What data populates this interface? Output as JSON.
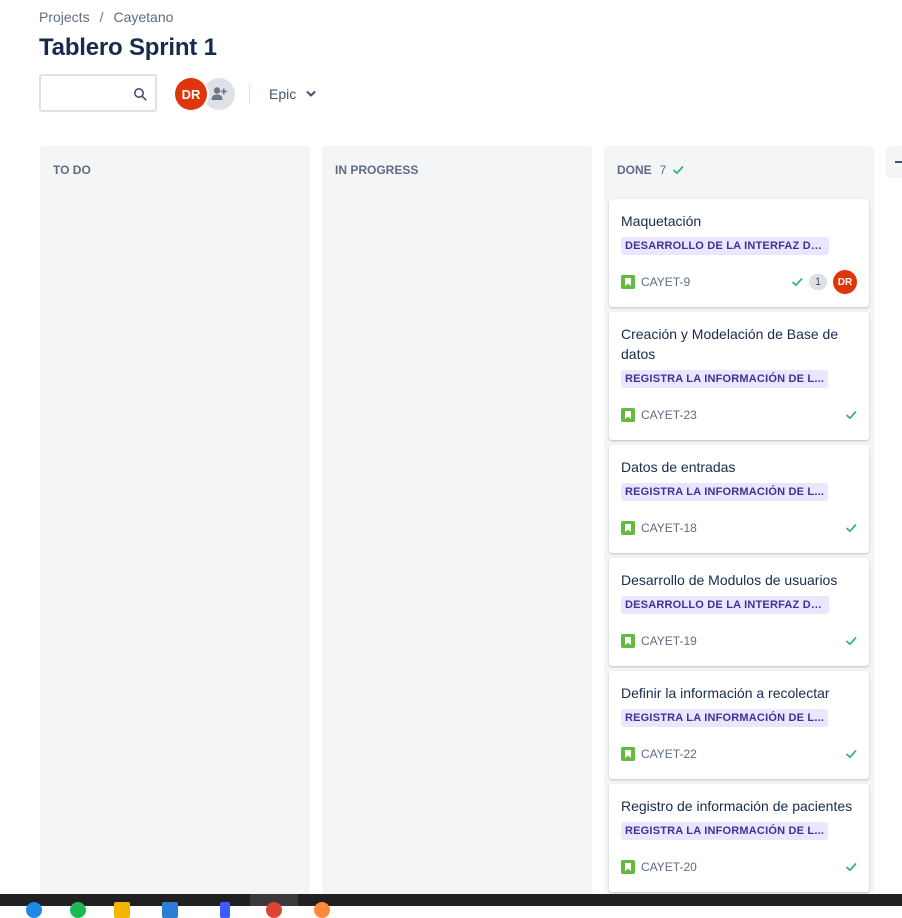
{
  "breadcrumb": {
    "items": [
      "Projects",
      "Cayetano"
    ],
    "separator": "/"
  },
  "page_title": "Tablero Sprint 1",
  "toolbar": {
    "search": {
      "value": "",
      "placeholder": ""
    },
    "avatar_initials": "DR",
    "epic_filter": "Epic"
  },
  "columns": [
    {
      "name": "TO DO"
    },
    {
      "name": "IN PROGRESS"
    },
    {
      "name": "DONE",
      "count": "7"
    }
  ],
  "cards": [
    {
      "summary": "Maquetación",
      "epic": "DESARROLLO DE LA INTERFAZ DE ...",
      "key": "CAYET-9",
      "subtasks": "1",
      "assignee": "DR"
    },
    {
      "summary": "Creación y Modelación de Base de datos",
      "epic": "REGISTRA LA INFORMACIÓN DE L...",
      "key": "CAYET-23"
    },
    {
      "summary": "Datos de entradas",
      "epic": "REGISTRA LA INFORMACIÓN DE L...",
      "key": "CAYET-18"
    },
    {
      "summary": "Desarrollo de Modulos de usuarios",
      "epic": "DESARROLLO DE LA INTERFAZ DE ...",
      "key": "CAYET-19"
    },
    {
      "summary": "Definir la información a recolectar",
      "epic": "REGISTRA LA INFORMACIÓN DE L...",
      "key": "CAYET-22"
    },
    {
      "summary": "Registro de información de pacientes",
      "epic": "REGISTRA LA INFORMACIÓN DE L...",
      "key": "CAYET-20"
    }
  ],
  "colors": {
    "epic_lozenge_bg": "#eae6ff",
    "epic_lozenge_text": "#403294",
    "story_icon": "#63ba3c",
    "avatar": "#de350b",
    "done_check": "#36b37e"
  },
  "icons": {
    "search": "search-icon",
    "add_people": "add-person-icon",
    "chevron": "chevron-down-icon",
    "story": "story-icon",
    "done": "check-icon"
  }
}
